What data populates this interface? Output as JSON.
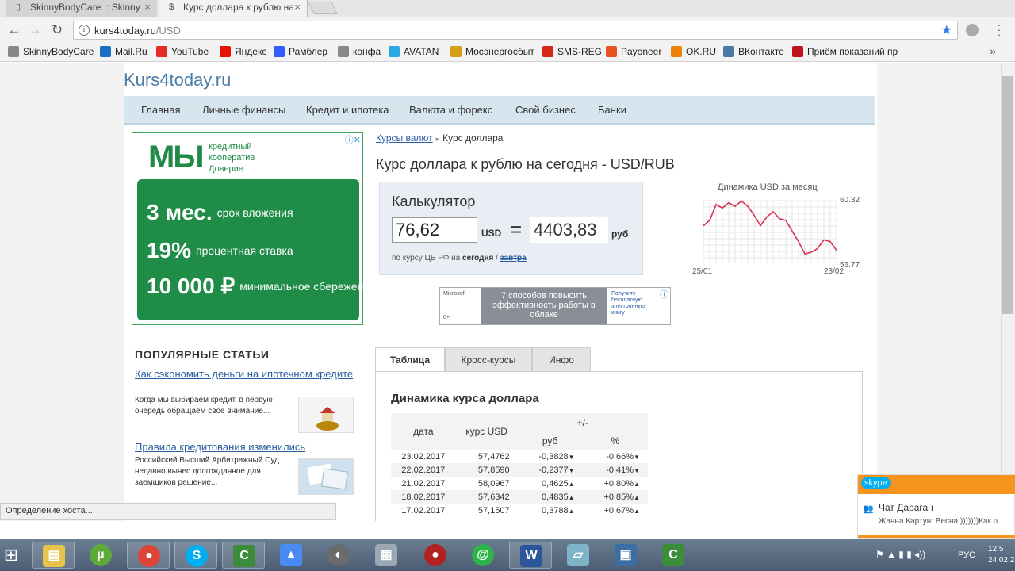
{
  "browser": {
    "tabs": [
      {
        "title": "SkinnyBodyCare :: Skinny"
      },
      {
        "title": "Курс доллара к рублю на"
      }
    ],
    "url_host": "kurs4today.ru",
    "url_path": "/USD",
    "bookmarks": [
      {
        "label": "SkinnyBodyCare",
        "icon": "page-icon",
        "color": "#888888"
      },
      {
        "label": "Mail.Ru",
        "icon": "mailru-icon",
        "color": "#1a6fc4"
      },
      {
        "label": "YouTube",
        "icon": "youtube-icon",
        "color": "#e52d27"
      },
      {
        "label": "Яндекс",
        "icon": "yandex-icon",
        "color": "#e61400"
      },
      {
        "label": "Рамблер",
        "icon": "rambler-icon",
        "color": "#315efb"
      },
      {
        "label": "конфа",
        "icon": "page-icon",
        "color": "#888888"
      },
      {
        "label": "AVATAN",
        "icon": "avatan-icon",
        "color": "#2aa8e0"
      },
      {
        "label": "Мосэнергосбыт",
        "icon": "mosenergo-icon",
        "color": "#d4a017"
      },
      {
        "label": "SMS-REG",
        "icon": "smsreg-icon",
        "color": "#d9241c"
      },
      {
        "label": "Payoneer",
        "icon": "payoneer-icon",
        "color": "#e8541e"
      },
      {
        "label": "OK.RU",
        "icon": "ok-icon",
        "color": "#ee8208"
      },
      {
        "label": "ВКонтакте",
        "icon": "vk-icon",
        "color": "#4a76a8"
      },
      {
        "label": "Приём показаний пр",
        "icon": "bookmark-icon",
        "color": "#c0141c"
      }
    ],
    "more": "»"
  },
  "site": {
    "logo": "Kurs4today.ru",
    "nav": [
      "Главная",
      "Личные финансы",
      "Кредит и ипотека",
      "Валюта и форекс",
      "Свой бизнес",
      "Банки"
    ]
  },
  "ad_left": {
    "brand": "МЫ",
    "brand_sub": "кредитный кооператив Доверие",
    "rows": [
      {
        "big": "3 мес.",
        "small": "срок вложения"
      },
      {
        "big": "19%",
        "small": "процентная ставка"
      },
      {
        "big": "10 000 ₽",
        "small": "минимальное сбережение"
      }
    ]
  },
  "breadcrumb": {
    "link": "Курсы валют",
    "current": "Курс доллара"
  },
  "title": "Курс доллара к рублю на сегодня - USD/RUB",
  "calculator": {
    "title": "Калькулятор",
    "input_value": "76,62",
    "from": "USD",
    "equals": "=",
    "result": "4403,83",
    "to": "руб",
    "note_prefix": "по курсу ЦБ РФ на",
    "note_today": "сегодня",
    "note_sep": "/",
    "note_tomorrow": "завтра"
  },
  "mini_chart_text": {
    "title": "Динамика USD за месяц",
    "y_max": "60.32",
    "y_min": "56.77",
    "x_start": "25/01",
    "x_end": "23/02"
  },
  "chart_data": {
    "type": "line",
    "title": "Динамика USD за месяц",
    "x_range": [
      "25/01",
      "23/02"
    ],
    "ylim": [
      56.77,
      60.32
    ],
    "values": [
      58.9,
      59.2,
      60.1,
      59.9,
      60.2,
      60.0,
      60.3,
      60.0,
      59.5,
      58.9,
      59.4,
      59.7,
      59.3,
      59.2,
      58.6,
      58.0,
      57.3,
      57.4,
      57.6,
      58.1,
      58.0,
      57.5
    ],
    "grid": true
  },
  "ad_mid": {
    "brand": "Microsoft",
    "text": "7 способов повысить эффективность работы в облаке",
    "side": "Получите бесплатную электронную книгу",
    "tag": "0+"
  },
  "popular": {
    "title": "ПОПУЛЯРНЫЕ СТАТЬИ",
    "articles": [
      {
        "title": "Как сэкономить деньги на ипотечном кредите",
        "text": "Когда мы выбираем кредит, в первую очередь обращаем свое внимание..."
      },
      {
        "title": "Правила кредитования изменились",
        "text": "Российский Высший Арбитражный Суд недавно вынес долгожданное для заемщиков решение..."
      }
    ]
  },
  "tabs": [
    "Таблица",
    "Кросс-курсы",
    "Инфо"
  ],
  "table": {
    "title": "Динамика курса доллара",
    "headers": {
      "date": "дата",
      "rate": "курс USD",
      "change": "+/-",
      "rub": "руб",
      "pct": "%"
    },
    "rows": [
      {
        "date": "23.02.2017",
        "rate": "57,4762",
        "rub": "-0,3828",
        "pct": "-0,66%",
        "dir": "down"
      },
      {
        "date": "22.02.2017",
        "rate": "57,8590",
        "rub": "-0,2377",
        "pct": "-0,41%",
        "dir": "down"
      },
      {
        "date": "21.02.2017",
        "rate": "58,0967",
        "rub": "0,4625",
        "pct": "+0,80%",
        "dir": "up"
      },
      {
        "date": "18.02.2017",
        "rate": "57,6342",
        "rub": "0,4835",
        "pct": "+0,85%",
        "dir": "up"
      },
      {
        "date": "17.02.2017",
        "rate": "57,1507",
        "rub": "0,3788",
        "pct": "+0,67%",
        "dir": "up"
      }
    ]
  },
  "status": "Определение хоста...",
  "skype": {
    "brand": "skype",
    "chat": "Чат Дараган",
    "message": "Жанна Картун: Весна )))))))Как п"
  },
  "taskbar": {
    "lang": "РУС",
    "time": "12:5",
    "date": "24.02.2"
  }
}
